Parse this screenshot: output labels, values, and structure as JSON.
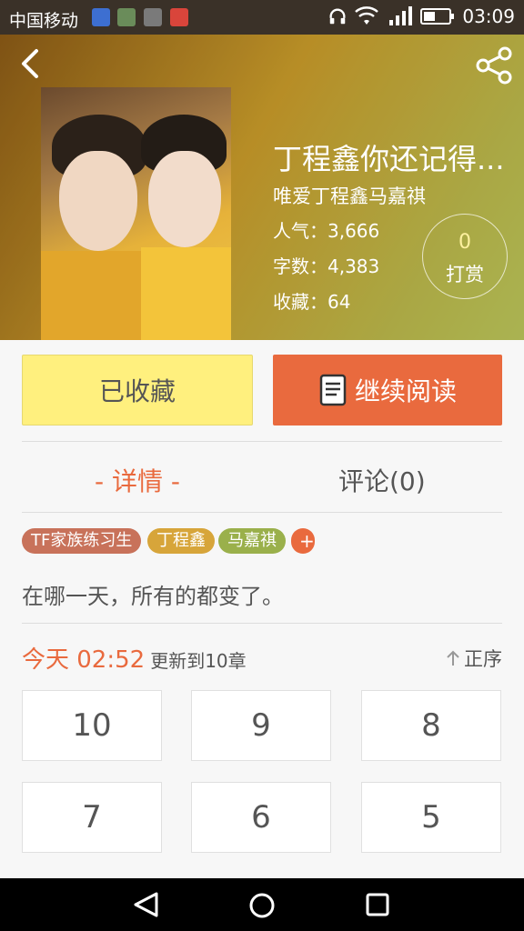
{
  "status_bar": {
    "carrier": "中国移动",
    "time": "03:09"
  },
  "book": {
    "title": "丁程鑫你还记得...",
    "author": "唯爱丁程鑫马嘉祺",
    "popularity": "人气：3,666",
    "word_count": "字数：4,383",
    "favorites": "收藏：64",
    "tip_count": "0",
    "tip_label": "打赏"
  },
  "actions": {
    "favorite_label": "已收藏",
    "read_label": "继续阅读"
  },
  "tabs": {
    "details": "- 详情 -",
    "comments": "评论(0)"
  },
  "tags": [
    {
      "label": "TF家族练习生",
      "color": "#c8725a"
    },
    {
      "label": "丁程鑫",
      "color": "#d7a53a"
    },
    {
      "label": "马嘉祺",
      "color": "#9ab04b"
    }
  ],
  "tag_add": "+",
  "description": "在哪一天，所有的都变了。",
  "update": {
    "time": "今天 02:52",
    "text": "更新到10章"
  },
  "sort_label": "正序",
  "chapters": [
    "10",
    "9",
    "8",
    "7",
    "6",
    "5"
  ],
  "colors": {
    "accent": "#e96a3e",
    "favorite_bg": "#fff07e"
  },
  "icons": {
    "back": "chevron-left-icon",
    "share": "share-icon",
    "book": "book-icon",
    "sort": "arrow-up-icon",
    "nav_back": "triangle-back-icon",
    "nav_home": "circle-home-icon",
    "nav_recent": "square-recent-icon"
  }
}
